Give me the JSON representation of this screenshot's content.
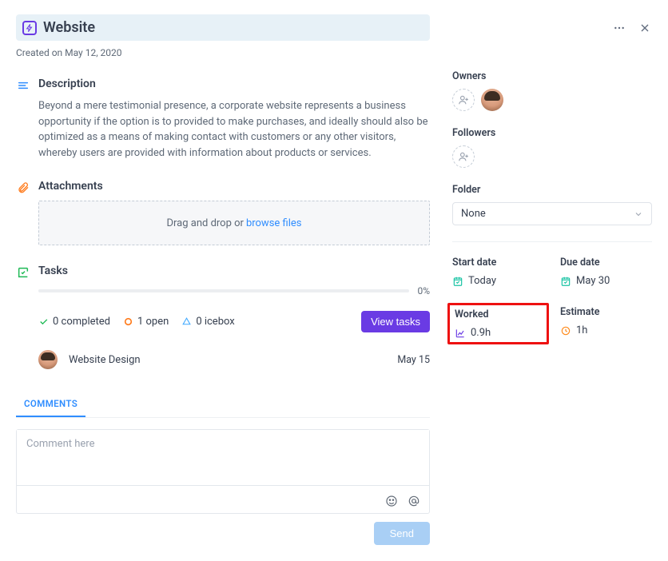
{
  "header": {
    "title": "Website",
    "created": "Created on May 12, 2020",
    "icon": "bolt-icon"
  },
  "description": {
    "heading": "Description",
    "text": "Beyond a mere testimonial presence, a corporate website represents a business opportunity if the option is to provided to make purchases, and ideally should also be optimized as a means of making contact with customers or any other visitors, whereby users are provided with information about products or services."
  },
  "attachments": {
    "heading": "Attachments",
    "drop_text": "Drag and drop or",
    "browse": "browse files"
  },
  "tasks": {
    "heading": "Tasks",
    "progress_pct": "0%",
    "completed": "0 completed",
    "open": "1 open",
    "icebox": "0 icebox",
    "view_button": "View tasks",
    "item_name": "Website Design",
    "item_date": "May 15"
  },
  "comments": {
    "tab": "COMMENTS",
    "placeholder": "Comment here",
    "send": "Send"
  },
  "sidebar": {
    "owners_label": "Owners",
    "followers_label": "Followers",
    "folder_label": "Folder",
    "folder_value": "None",
    "start_date_label": "Start date",
    "start_date_value": "Today",
    "due_date_label": "Due date",
    "due_date_value": "May 30",
    "worked_label": "Worked",
    "worked_value": "0.9h",
    "estimate_label": "Estimate",
    "estimate_value": "1h"
  }
}
